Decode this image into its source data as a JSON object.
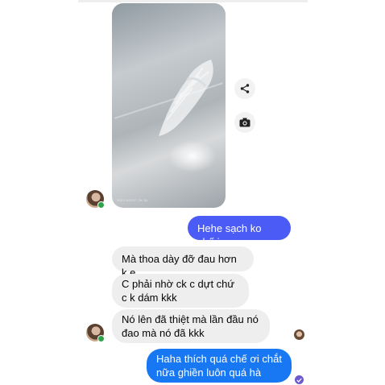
{
  "photo": {
    "timestamp": "2021/03/07 20:34"
  },
  "icons": {
    "share": "share-icon",
    "camera": "camera-icon",
    "sent": "check-icon"
  },
  "messages": [
    {
      "side": "outgoing",
      "text": "Hehe sạch ko chế iu"
    },
    {
      "side": "incoming",
      "text": "Mà thoa dày đỡ đau hơn k e"
    },
    {
      "side": "incoming",
      "text": "C phải nhờ ck c dựt chứ c k dám kkk"
    },
    {
      "side": "incoming",
      "text": "Nó lên đã thiệt mà lần đầu nó đao mà nó đã kkk"
    },
    {
      "side": "outgoing",
      "text": "Haha thích quá chế ơi chắt nữa ghiền luôn quá hà"
    }
  ],
  "colors": {
    "outgoing_1": "#4a5cf5",
    "outgoing_2": "#1877f2",
    "incoming": "#eeeeee",
    "online": "#31a24c"
  }
}
